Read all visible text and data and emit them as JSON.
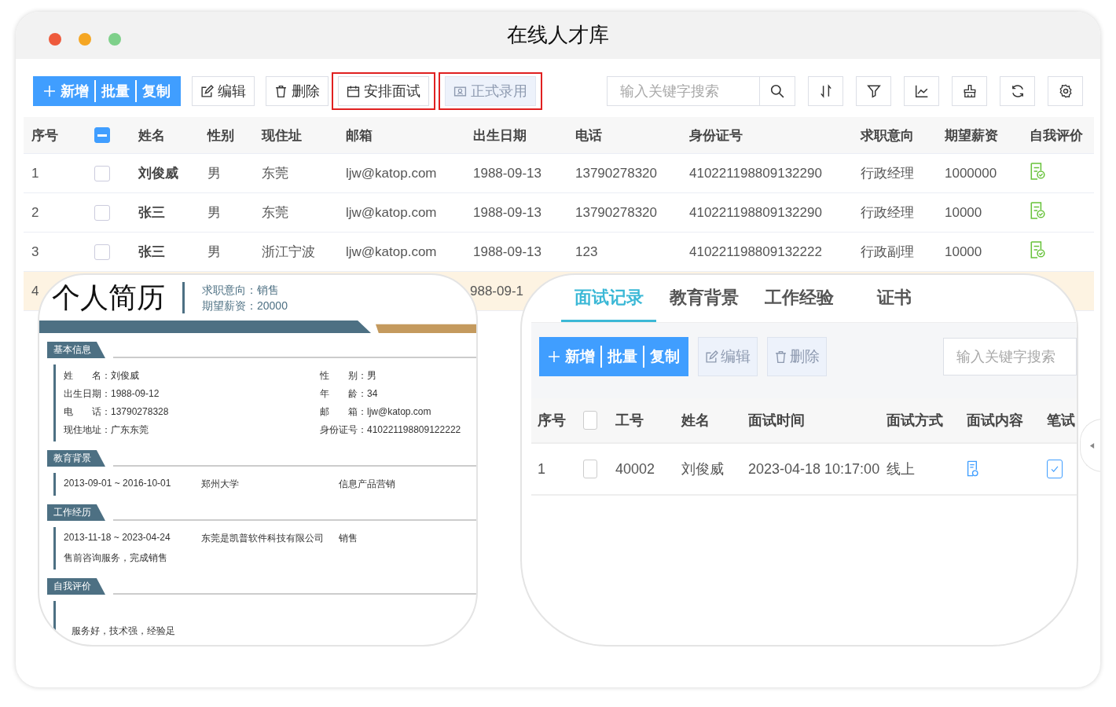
{
  "window": {
    "title": "在线人才库"
  },
  "toolbar": {
    "split_button": [
      "新增",
      "批量",
      "复制"
    ],
    "buttons": [
      {
        "label": "编辑",
        "disabled": false,
        "highlighted": false
      },
      {
        "label": "删除",
        "disabled": false,
        "highlighted": false
      },
      {
        "label": "安排面试",
        "disabled": false,
        "highlighted": true
      },
      {
        "label": "正式录用",
        "disabled": true,
        "highlighted": true
      }
    ],
    "search": {
      "placeholder": "输入关键字搜索"
    }
  },
  "table": {
    "columns": [
      "序号",
      "姓名",
      "性别",
      "现住址",
      "邮箱",
      "出生日期",
      "电话",
      "身份证号",
      "求职意向",
      "期望薪资",
      "自我评价"
    ],
    "select_all": {
      "indeterminate": true
    },
    "rows": [
      {
        "index": "1",
        "checked": false,
        "name": "刘俊威",
        "gender": "男",
        "address": "东莞",
        "email": "ljw@katop.com",
        "birth": "1988-09-13",
        "phone": "13790278320",
        "id_number": "410221198809132290",
        "intent": "行政经理",
        "salary": "1000000"
      },
      {
        "index": "2",
        "checked": false,
        "name": "张三",
        "gender": "男",
        "address": "东莞",
        "email": "ljw@katop.com",
        "birth": "1988-09-13",
        "phone": "13790278320",
        "id_number": "410221198809132290",
        "intent": "行政经理",
        "salary": "10000"
      },
      {
        "index": "3",
        "checked": false,
        "name": "张三",
        "gender": "男",
        "address": "浙江宁波",
        "email": "ljw@katop.com",
        "birth": "1988-09-13",
        "phone": "123",
        "id_number": "410221198809132222",
        "intent": "行政副理",
        "salary": "10000"
      }
    ],
    "partial_row": {
      "index": "4",
      "birth_fragment": "988-09-1",
      "highlighted": true
    }
  },
  "resume": {
    "title": "个人简历",
    "intent": "求职意向：销售",
    "salary": "期望薪资：20000",
    "sections": [
      {
        "kind": "info",
        "heading": "基本信息",
        "left": [
          "姓　　名：刘俊威",
          "出生日期：1988-09-12",
          "电　　话：13790278328",
          "现住地址：广东东莞"
        ],
        "right": [
          "性　　别：男",
          "年　　龄：34",
          "邮　　箱：ljw@katop.com",
          "身份证号：410221198809122222"
        ]
      },
      {
        "kind": "entries",
        "heading": "教育背景",
        "entries": [
          {
            "cols": [
              "2013-09-01 ~ 2016-10-01",
              "郑州大学",
              "信息产品营销"
            ]
          }
        ]
      },
      {
        "kind": "entries",
        "heading": "工作经历",
        "entries": [
          {
            "cols": [
              "2013-11-18 ~ 2023-04-24",
              "东莞是凯普软件科技有限公司",
              "销售"
            ],
            "note": "售前咨询服务，完成销售"
          }
        ]
      },
      {
        "kind": "text",
        "heading": "自我评价",
        "text": "服务好，技术强，经验足"
      }
    ]
  },
  "detail": {
    "tabs": [
      {
        "label": "面试记录",
        "selected": true
      },
      {
        "label": "教育背景",
        "selected": false
      },
      {
        "label": "工作经验",
        "selected": false
      },
      {
        "label": "证书",
        "selected": false
      }
    ],
    "split_button": [
      "新增",
      "批量",
      "复制"
    ],
    "buttons": [
      {
        "label": "编辑",
        "disabled": true
      },
      {
        "label": "删除",
        "disabled": true
      }
    ],
    "search": {
      "placeholder": "输入关键字搜索"
    },
    "select_all_checked": false,
    "columns": [
      "序号",
      "工号",
      "姓名",
      "面试时间",
      "面试方式",
      "面试内容",
      "笔试"
    ],
    "rows": [
      {
        "index": "1",
        "checked": false,
        "employee_no": "40002",
        "name": "刘俊威",
        "time": "2023-04-18 10:17:00",
        "method": "线上",
        "written_done": true
      }
    ]
  }
}
